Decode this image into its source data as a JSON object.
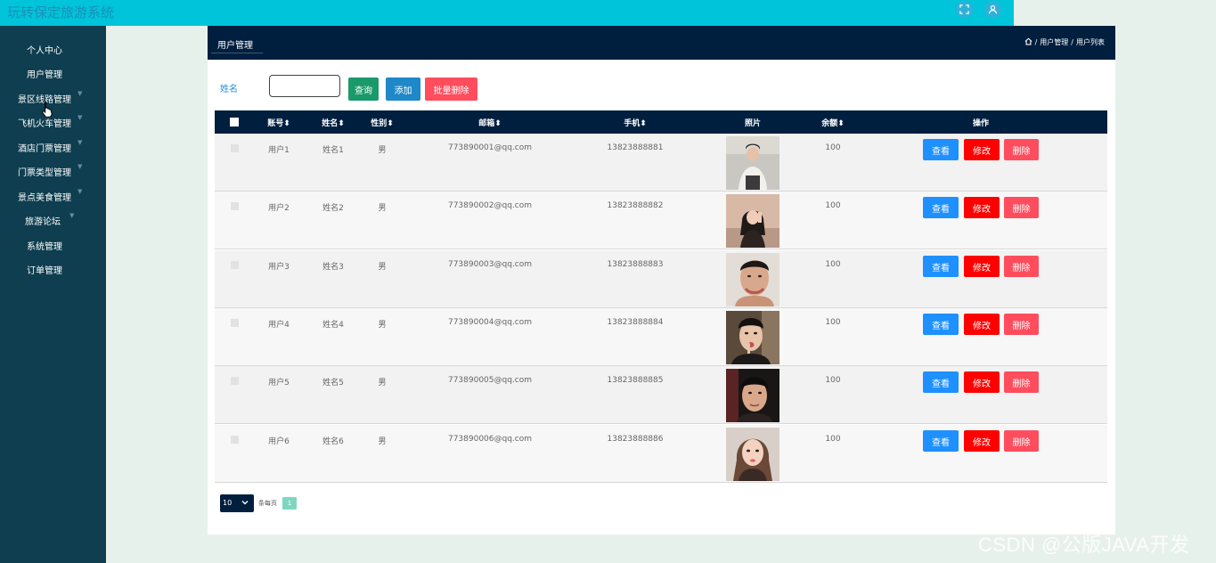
{
  "app": {
    "title": "玩转保定旅游系统"
  },
  "sidebar": {
    "items": [
      {
        "label": "个人中心",
        "has_arrow": false
      },
      {
        "label": "用户管理",
        "has_arrow": false
      },
      {
        "label": "景区线路管理",
        "has_arrow": true
      },
      {
        "label": "飞机火车管理",
        "has_arrow": true
      },
      {
        "label": "酒店门票管理",
        "has_arrow": true
      },
      {
        "label": "门票类型管理",
        "has_arrow": true
      },
      {
        "label": "景点美食管理",
        "has_arrow": true
      },
      {
        "label": "旅游论坛",
        "has_arrow": true
      },
      {
        "label": "系统管理",
        "has_arrow": false
      },
      {
        "label": "订单管理",
        "has_arrow": false
      }
    ]
  },
  "panel": {
    "tab_label": "用户管理",
    "breadcrumb": [
      "用户管理",
      "用户列表"
    ],
    "breadcrumb_separator": "/"
  },
  "search": {
    "label": "姓名",
    "value": "",
    "query_label": "查询",
    "add_label": "添加",
    "batch_delete_label": "批量删除"
  },
  "table": {
    "sort_glyph": "⬍",
    "columns": [
      "账号",
      "姓名",
      "性别",
      "邮箱",
      "手机",
      "照片",
      "余额",
      "操作"
    ],
    "rows": [
      {
        "account": "用户1",
        "name": "姓名1",
        "gender": "男",
        "email": "773890001@qq.com",
        "phone": "13823888881",
        "balance": "100"
      },
      {
        "account": "用户2",
        "name": "姓名2",
        "gender": "男",
        "email": "773890002@qq.com",
        "phone": "13823888882",
        "balance": "100"
      },
      {
        "account": "用户3",
        "name": "姓名3",
        "gender": "男",
        "email": "773890003@qq.com",
        "phone": "13823888883",
        "balance": "100"
      },
      {
        "account": "用户4",
        "name": "姓名4",
        "gender": "男",
        "email": "773890004@qq.com",
        "phone": "13823888884",
        "balance": "100"
      },
      {
        "account": "用户5",
        "name": "姓名5",
        "gender": "男",
        "email": "773890005@qq.com",
        "phone": "13823888885",
        "balance": "100"
      },
      {
        "account": "用户6",
        "name": "姓名6",
        "gender": "男",
        "email": "773890006@qq.com",
        "phone": "13823888886",
        "balance": "100"
      }
    ],
    "actions": {
      "view": "查看",
      "edit": "修改",
      "delete": "删除"
    }
  },
  "pagination": {
    "page_size": "10",
    "page_size_label": "条每页",
    "current_page": "1"
  },
  "watermark": "CSDN @公版JAVA开发",
  "colors": {
    "topbar": "#00c4da",
    "sidebar": "#0e3e4f",
    "panel_header": "#001f3f",
    "query_button": "#1a9a6b",
    "add_button": "#1e88c8",
    "batch_delete_button": "#ff4d5e",
    "view_button": "#1e90ff",
    "edit_button": "#ff0000",
    "delete_button": "#ff4d5e",
    "page_active": "#7fd6c0"
  },
  "icons": {
    "fullscreen": "expand-icon",
    "user": "user-icon",
    "home": "home-icon",
    "caret": "chevron-down-icon",
    "cursor": "hand-pointer-icon"
  }
}
